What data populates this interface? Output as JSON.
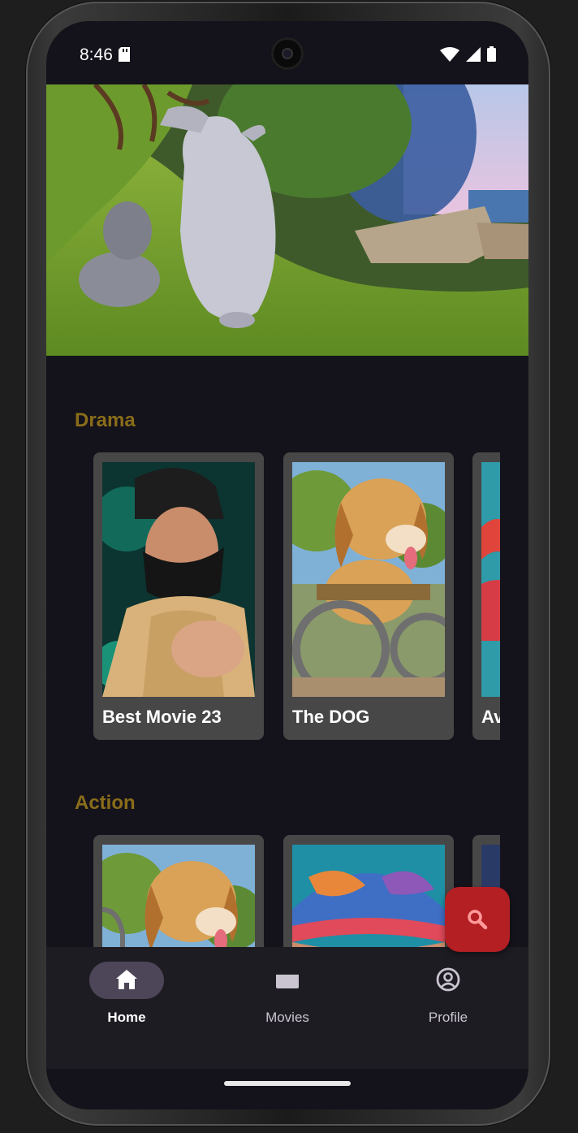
{
  "status_bar": {
    "time": "8:46"
  },
  "rows": [
    {
      "title": "Drama",
      "items": [
        {
          "title": "Best Movie 23"
        },
        {
          "title": "The DOG"
        },
        {
          "title": "Av"
        }
      ]
    },
    {
      "title": "Action",
      "items": [
        {
          "title": ""
        },
        {
          "title": ""
        },
        {
          "title": ""
        }
      ]
    }
  ],
  "fab": {
    "icon": "search-icon",
    "color": "#b41f24"
  },
  "bottom_nav": {
    "active": "Home",
    "items": [
      {
        "label": "Home",
        "icon": "home-icon"
      },
      {
        "label": "Movies",
        "icon": "movie-clapper-icon"
      },
      {
        "label": "Profile",
        "icon": "account-circle-icon"
      }
    ]
  },
  "colors": {
    "background": "#14121a",
    "section_title": "#8a6d1a",
    "card": "#474747",
    "nav_background": "#1e1c23",
    "nav_active_pill": "#4d4659"
  }
}
